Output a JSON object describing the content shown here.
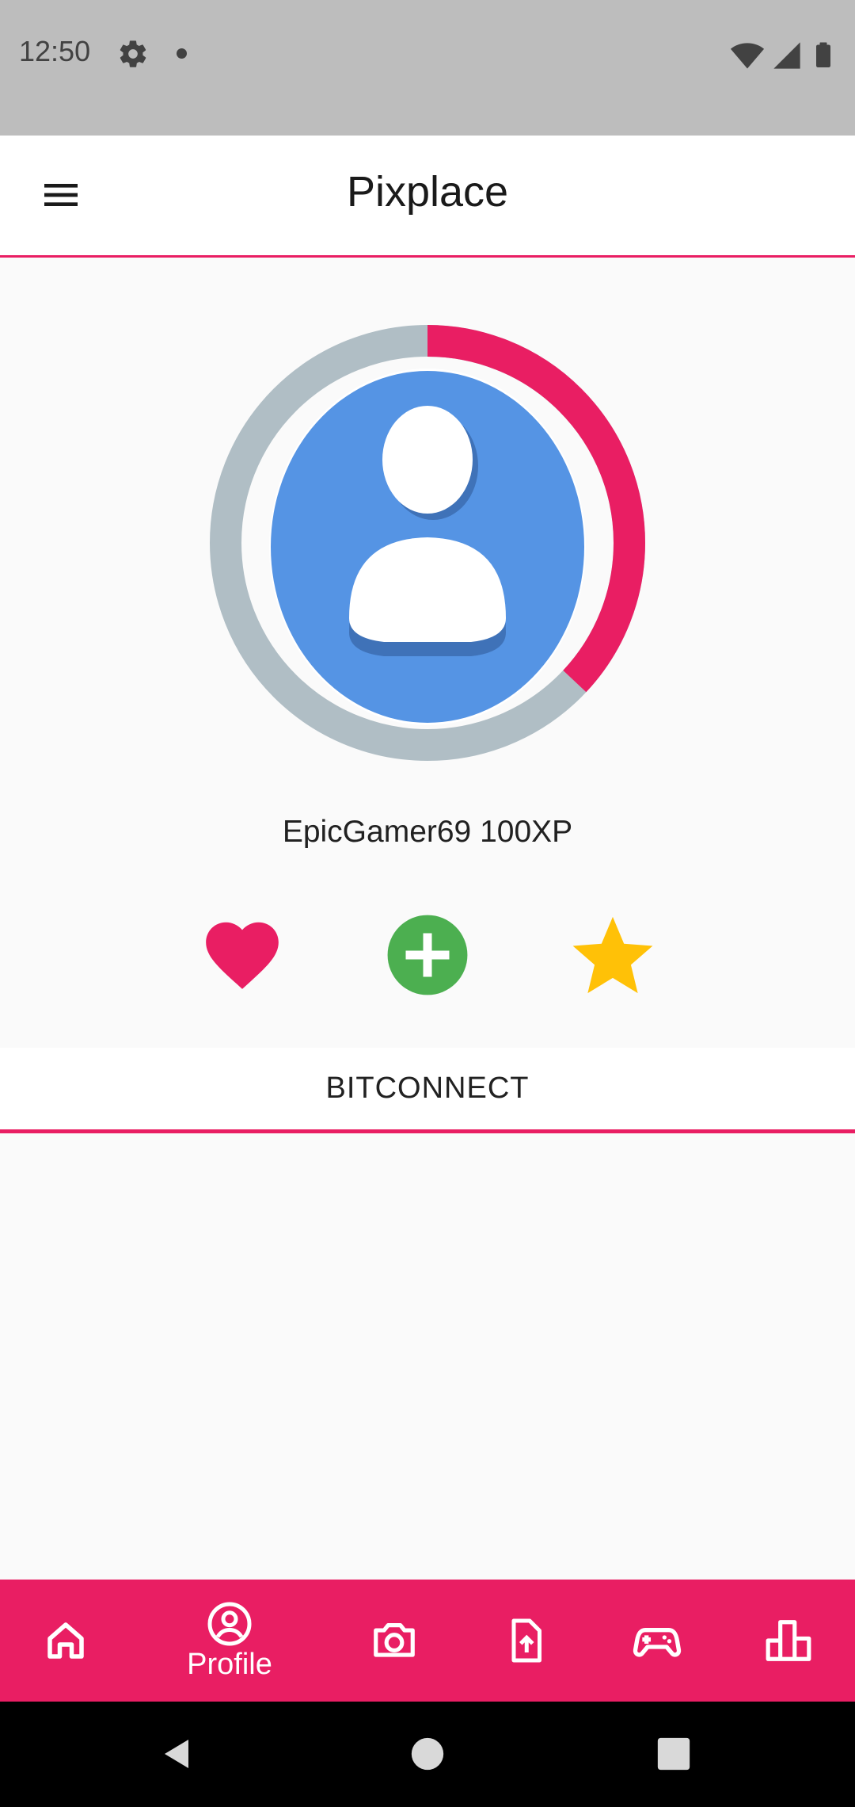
{
  "status_bar": {
    "time": "12:50"
  },
  "app_bar": {
    "title": "Pixplace"
  },
  "profile": {
    "username": "EpicGamer69 100XP",
    "xp_progress": 0.37
  },
  "actions": [
    "heart-icon",
    "add-circle-icon",
    "star-icon"
  ],
  "tab": {
    "label": "BITCONNECT"
  },
  "bottom_nav": {
    "items": [
      {
        "icon": "home-icon",
        "label": ""
      },
      {
        "icon": "profile-icon",
        "label": "Profile",
        "active": true
      },
      {
        "icon": "camera-icon",
        "label": ""
      },
      {
        "icon": "upload-icon",
        "label": ""
      },
      {
        "icon": "gamepad-icon",
        "label": ""
      },
      {
        "icon": "leaderboard-icon",
        "label": ""
      }
    ]
  },
  "colors": {
    "accent": "#e91e63",
    "ring_track": "#b0bec5",
    "avatar_bg": "#5594e4",
    "add_green": "#4caf50",
    "star_yellow": "#ffc107"
  }
}
